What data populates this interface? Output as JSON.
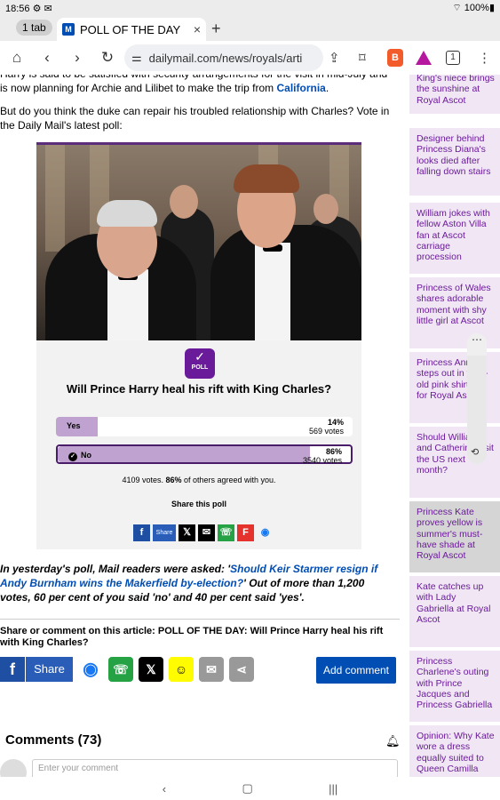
{
  "status": {
    "time": "18:56",
    "notif": "⚙ ✉",
    "battery": "100%"
  },
  "tabs": {
    "count_label": "1 tab",
    "tab_title": "POLL OF THE DAY",
    "favicon": "M"
  },
  "url": "dailymail.com/news/royals/arti",
  "toolbar": {
    "tabs_count": "1"
  },
  "article": {
    "para1_partial": "Harry is said to be satisfied with security arrangements for the visit in mid-July and is now planning for Archie and Lilibet to make the trip from ",
    "para1_link": "California",
    "para1_end": ".",
    "para2": "But do you think the duke can repair his troubled relationship with Charles? Vote in the Daily Mail's latest poll:"
  },
  "poll": {
    "icon_label": "POLL",
    "question": "Will Prince Harry heal his rift with King Charles?",
    "options": [
      {
        "name": "Yes",
        "pct": "14%",
        "votes": "569 votes",
        "fraction": 0.14
      },
      {
        "name": "No",
        "pct": "86%",
        "votes": "3540 votes",
        "fraction": 0.86
      }
    ],
    "total_pre": "4109 votes. ",
    "total_bold": "86%",
    "total_post": " of others agreed with you.",
    "share_label": "Share this poll",
    "mini_share_label": "Share"
  },
  "yesterday": {
    "pre": "In yesterday's poll, Mail readers were asked: '",
    "link": "Should Keir Starmer resign if Andy Burnham wins the Makerfield by-election?",
    "post": "' Out of more than 1,200 votes, 60 per cent of you said 'no' and 40 per cent said 'yes'."
  },
  "share": {
    "title": "Share or comment on this article: POLL OF THE DAY: Will Prince Harry heal his rift with King Charles?",
    "fb_label": "Share",
    "add_comment": "Add comment"
  },
  "comments": {
    "title": "Comments (73)",
    "placeholder": "Enter your comment"
  },
  "sidebar": [
    "King's niece brings the sunshine at Royal Ascot",
    "Designer behind Princess Diana's looks died after falling down stairs",
    "William jokes with fellow Aston Villa fan at Ascot carriage procession",
    "Princess of Wales shares adorable moment with shy little girl at Ascot",
    "Princess Anne steps out in year-old pink shirt suit for Royal Ascot",
    "Should William and Catherine visit the US next month?",
    "Princess Kate proves yellow is summer's must-have shade at Royal Ascot",
    "Kate catches up with Lady Gabriella at Royal Ascot",
    "Princess Charlene's outing with Prince Jacques and Princess Gabriella",
    "Opinion: Why Kate wore a dress equally suited to Queen Camilla"
  ],
  "colors": {
    "accent": "#6a1b9a",
    "link": "#004db3",
    "sidebar_bg": "#f1e7f4"
  }
}
